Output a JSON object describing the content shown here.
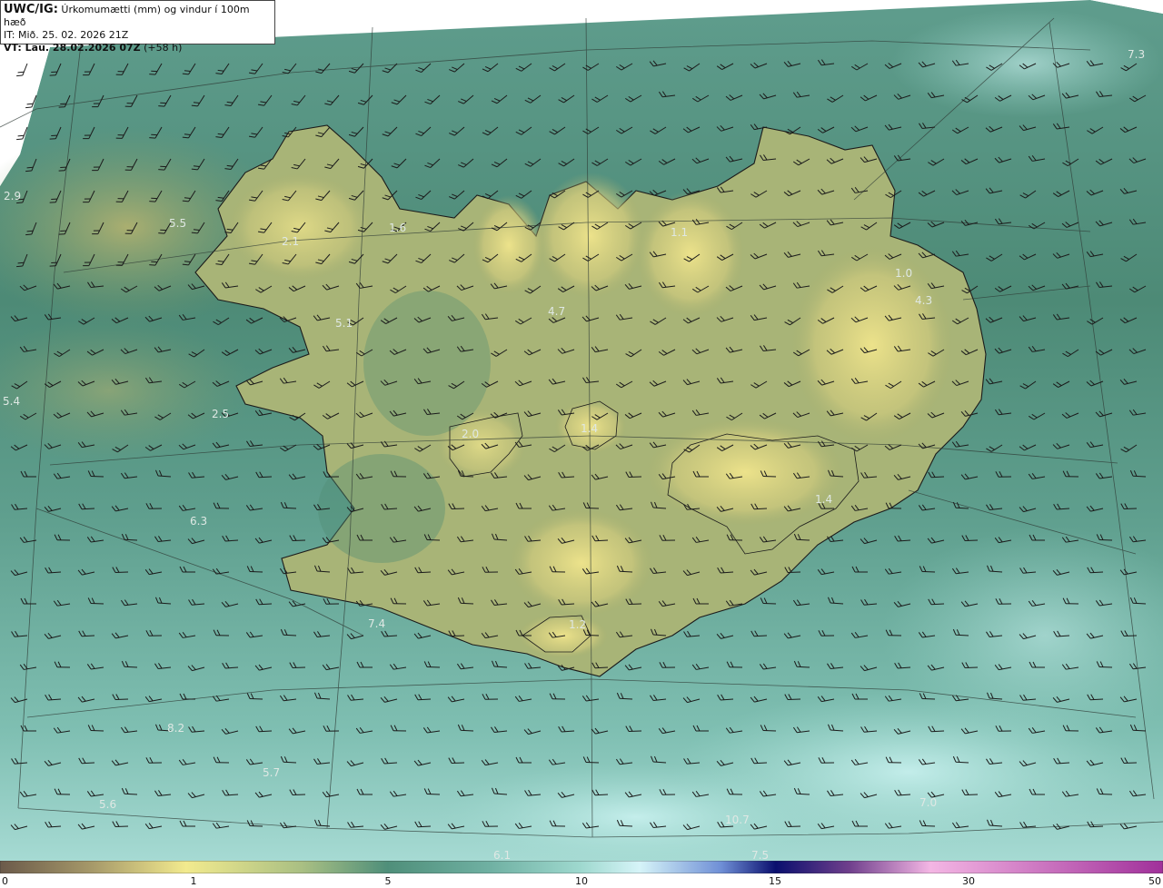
{
  "header": {
    "model": "UWC/IG:",
    "title": "Úrkomumætti (mm) og vindur í 100m hæð",
    "it_line": "IT: Mið. 25. 02. 2026 21Z",
    "vt_prefix": "VT: Lau. 28.02.2026 07Z",
    "vt_suffix": "(+58 h)"
  },
  "colorbar": {
    "ticks": [
      "0",
      "1",
      "5",
      "10",
      "15",
      "30",
      "50"
    ],
    "colors": [
      "#6b5a4a",
      "#a79a6a",
      "#f2ea8e",
      "#4f8f7a",
      "#9fd9cf",
      "#d6f4f8",
      "#0a0f6e",
      "#f4b6e4",
      "#a0309a"
    ]
  },
  "value_labels": [
    "7.3",
    "2.9",
    "5.5",
    "2.1",
    "1.6",
    "1.1",
    "1.0",
    "4.3",
    "5.1",
    "4.7",
    "5.4",
    "2.5",
    "2.0",
    "1.4",
    "1.4",
    "6.3",
    "7.4",
    "1.2",
    "8.2",
    "5.7",
    "5.6",
    "6.1",
    "10.7",
    "7.5",
    "7.0"
  ],
  "icons": {
    "wind_barb": "wind-barb-icon",
    "coastline": "coastline-line"
  }
}
